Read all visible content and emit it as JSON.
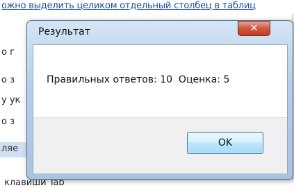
{
  "background": {
    "top_text": "ожно выделить целиком отдельный столбец в таблиц",
    "side_fragments": [
      "о г",
      "о з",
      "у ук",
      "о з"
    ],
    "band_text": "ляе",
    "bottom_text": "клавиши Tab"
  },
  "dialog": {
    "title": "Результат",
    "message": "Правильных ответов: 10  Оценка: 5",
    "ok_label": "OK",
    "close_glyph": "✕"
  },
  "colors": {
    "frame": "#b6cfe8",
    "close": "#c13a22",
    "ok_border": "#3c7fb1"
  }
}
